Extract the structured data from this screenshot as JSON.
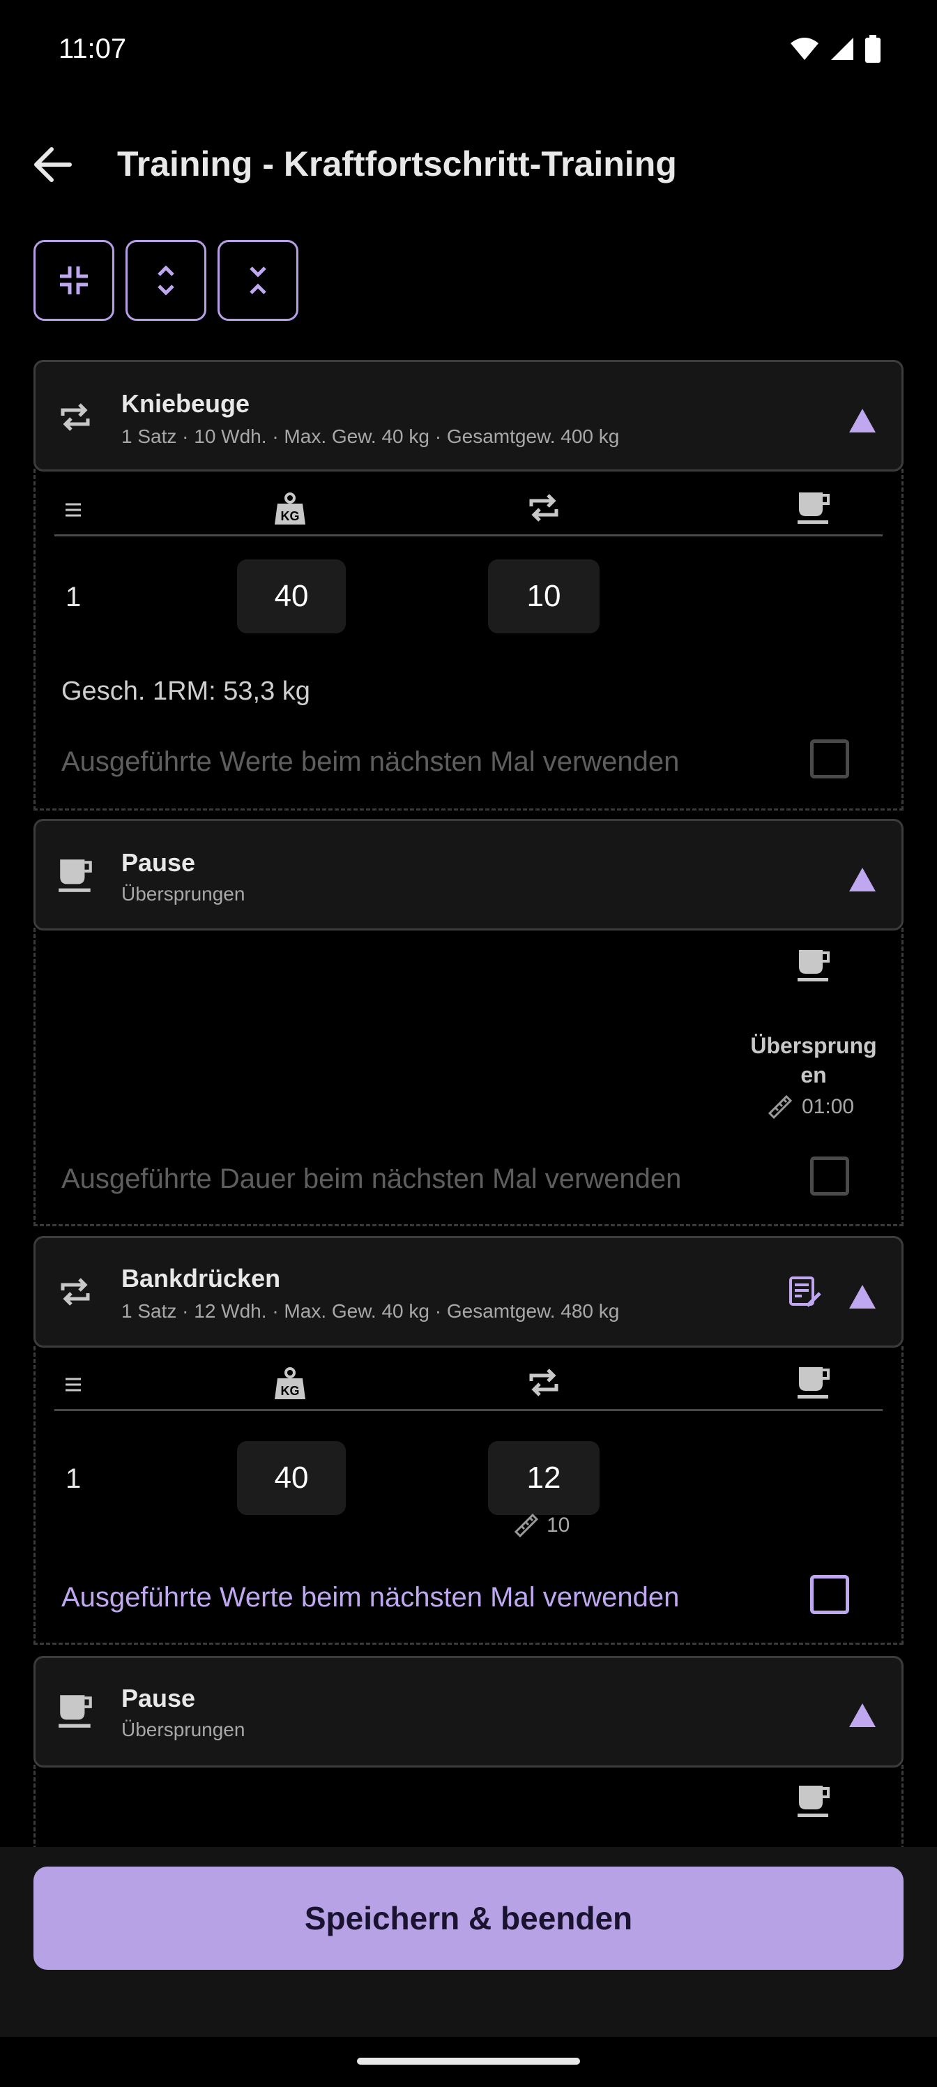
{
  "status": {
    "time": "11:07"
  },
  "header": {
    "title": "Training - Kraftfortschritt-Training"
  },
  "toolbar": {
    "buttons": [
      "collapse-all",
      "expand-vertical",
      "collapse-vertical"
    ]
  },
  "exercise1": {
    "name": "Kniebeuge",
    "summary": "1 Satz · 10 Wdh. · Max. Gew. 40 kg · Gesamtgew. 400 kg",
    "set_number": "1",
    "weight": "40",
    "reps": "10",
    "one_rm": "Gesch. 1RM: 53,3 kg",
    "reuse_label": "Ausgeführte Werte beim nächsten Mal verwenden",
    "reuse_checked": false
  },
  "pause1": {
    "name": "Pause",
    "status": "Übersprungen",
    "skipped_label_line1": "Übersprung",
    "skipped_label_line2": "en",
    "duration": "01:00",
    "reuse_label": "Ausgeführte Dauer beim nächsten Mal verwenden",
    "reuse_checked": false
  },
  "exercise2": {
    "name": "Bankdrücken",
    "summary": "1 Satz · 12 Wdh. · Max. Gew. 40 kg · Gesamtgew. 480 kg",
    "set_number": "1",
    "weight": "40",
    "reps": "12",
    "target_reps": "10",
    "reuse_label": "Ausgeführte Werte beim nächsten Mal verwenden",
    "reuse_checked": false
  },
  "pause2": {
    "name": "Pause",
    "status": "Übersprungen"
  },
  "footer": {
    "save_label": "Speichern & beenden"
  },
  "colors": {
    "accent": "#c0a8f0",
    "button": "#b8a2e6",
    "background": "#000000"
  }
}
